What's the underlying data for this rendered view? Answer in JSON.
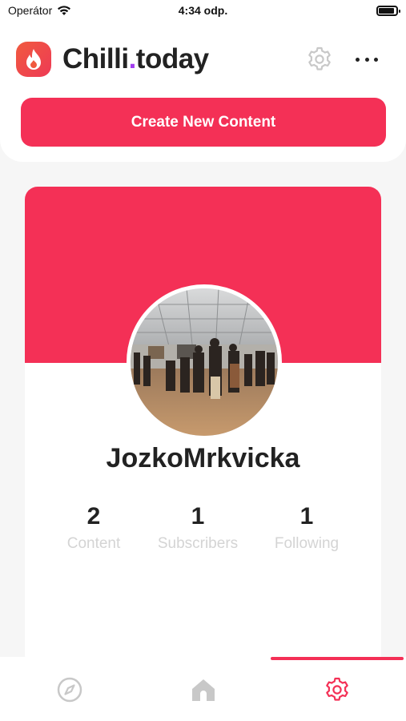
{
  "status_bar": {
    "carrier": "Operátor",
    "time": "4:34 odp."
  },
  "header": {
    "brand_main": "Chilli",
    "brand_dot": ".",
    "brand_suffix": "today",
    "icons": [
      "flame-icon",
      "gear-icon",
      "more-icon"
    ],
    "create_button_label": "Create New Content"
  },
  "profile": {
    "username": "JozkoMrkvicka",
    "stats": [
      {
        "value": "2",
        "label": "Content"
      },
      {
        "value": "1",
        "label": "Subscribers"
      },
      {
        "value": "1",
        "label": "Following"
      }
    ]
  },
  "tab_bar": {
    "tabs": [
      {
        "icon": "compass-icon"
      },
      {
        "icon": "home-icon"
      },
      {
        "icon": "gear-icon"
      }
    ],
    "active_index": 2
  },
  "colors": {
    "accent": "#f43056",
    "brand_dot": "#a23df0",
    "muted_label": "#d4d4d4",
    "inactive_icon": "#c8c8c8"
  }
}
